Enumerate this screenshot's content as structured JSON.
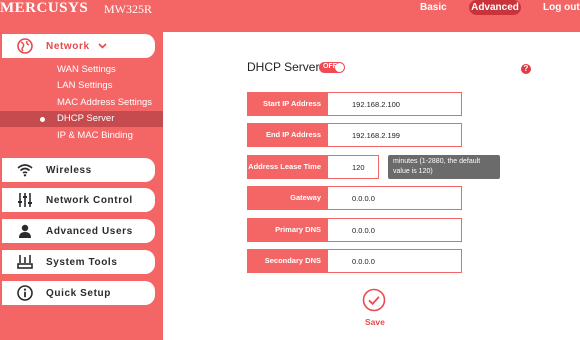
{
  "header": {
    "brand": "MERCUSYS",
    "model": "MW325R",
    "nav": {
      "basic": "Basic",
      "advanced": "Advanced",
      "logout": "Log out"
    }
  },
  "sidebar": {
    "network": {
      "label": "Network",
      "subitems": [
        {
          "label": "WAN Settings"
        },
        {
          "label": "LAN Settings"
        },
        {
          "label": "MAC Address Settings"
        },
        {
          "label": "DHCP Server",
          "selected": true
        },
        {
          "label": "IP & MAC Binding"
        }
      ]
    },
    "items": [
      {
        "label": "Wireless",
        "icon": "wifi-icon"
      },
      {
        "label": "Network Control",
        "icon": "sliders-icon"
      },
      {
        "label": "Advanced Users",
        "icon": "user-icon"
      },
      {
        "label": "System Tools",
        "icon": "tools-icon"
      },
      {
        "label": "Quick Setup",
        "icon": "info-icon"
      }
    ]
  },
  "main": {
    "title": "DHCP Server",
    "toggle_state": "OFF",
    "help": "?",
    "fields": [
      {
        "label": "Start IP Address",
        "value": "192.168.2.100"
      },
      {
        "label": "End IP Address",
        "value": "192.168.2.199"
      },
      {
        "label": "Address Lease Time",
        "value": "120",
        "hint": "minutes (1-2880, the default value is 120)"
      },
      {
        "label": "Gateway",
        "value": "0.0.0.0"
      },
      {
        "label": "Primary DNS",
        "value": "0.0.0.0"
      },
      {
        "label": "Secondary DNS",
        "value": "0.0.0.0"
      }
    ],
    "save_label": "Save"
  },
  "colors": {
    "accent": "#f46666",
    "accent_dark": "#c9333b",
    "tooltip": "#6b6b6b"
  }
}
